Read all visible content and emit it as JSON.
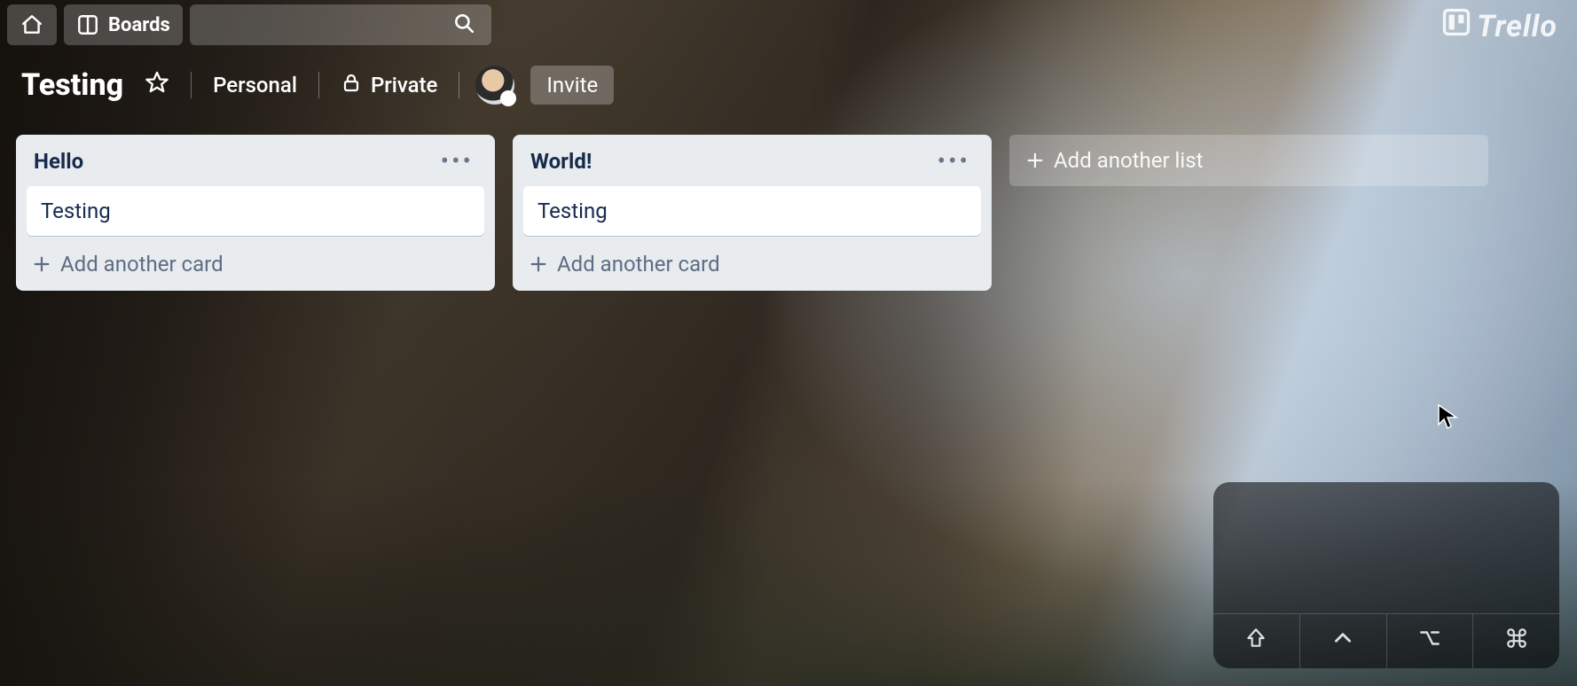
{
  "topbar": {
    "boards_label": "Boards"
  },
  "logo": {
    "text": "Trello"
  },
  "board_header": {
    "title": "Testing",
    "team_label": "Personal",
    "visibility_label": "Private",
    "invite_label": "Invite"
  },
  "lists": [
    {
      "title": "Hello",
      "cards": [
        {
          "title": "Testing"
        }
      ],
      "add_card_label": "Add another card"
    },
    {
      "title": "World!",
      "cards": [
        {
          "title": "Testing"
        }
      ],
      "add_card_label": "Add another card"
    }
  ],
  "add_list_label": "Add another list"
}
